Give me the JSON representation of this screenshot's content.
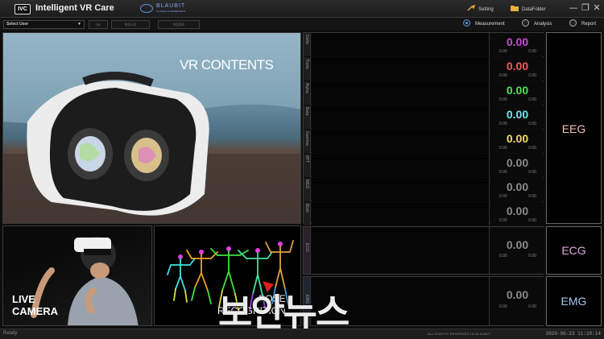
{
  "titlebar": {
    "logo": "IVC",
    "app_title": "Intelligent VR Care",
    "brand_name": "BLAUBIT",
    "brand_sub": "AI VISION & BIOMETRICS",
    "setting_label": "Setting",
    "datafolder_label": "DataFolder",
    "minimize_glyph": "—",
    "maximize_glyph": "❐",
    "close_glyph": "✕"
  },
  "toolbar": {
    "user_select_value": "Select User",
    "ok_label": "OK",
    "btn2_label": "측정시작",
    "btn3_label": "측정종료",
    "modes": [
      {
        "label": "Measurement",
        "selected": true
      },
      {
        "label": "Analysis",
        "selected": false
      },
      {
        "label": "Report",
        "selected": false
      }
    ]
  },
  "panels": {
    "vr_label": "VR CONTENTS",
    "camera_label_1": "LIVE",
    "camera_label_2": "CAMERA",
    "pose_label_1": "POSE",
    "pose_label_2": "RECOGNITION"
  },
  "eeg": {
    "section_label": "EEG",
    "section_color": "#f4c3b8",
    "channels": [
      {
        "name": "Delta",
        "value": "0.00",
        "min": "0.00",
        "max": "0.00",
        "color": "#c84bd6"
      },
      {
        "name": "Theta",
        "value": "0.00",
        "min": "0.00",
        "max": "0.00",
        "color": "#f05a5a"
      },
      {
        "name": "Alpha",
        "value": "0.00",
        "min": "0.00",
        "max": "0.00",
        "color": "#4fe05a"
      },
      {
        "name": "Beta",
        "value": "0.00",
        "min": "0.00",
        "max": "0.00",
        "color": "#6fe7f0"
      },
      {
        "name": "Gamma",
        "value": "0.00",
        "min": "0.00",
        "max": "0.00",
        "color": "#f5dc6a"
      },
      {
        "name": "ATT",
        "value": "0.00",
        "min": "0.00",
        "max": "0.00",
        "color": "#8a8a8a"
      },
      {
        "name": "MED",
        "value": "0.00",
        "min": "0.00",
        "max": "0.00",
        "color": "#8a8a8a"
      },
      {
        "name": "Blink",
        "value": "0.00",
        "min": "0.00",
        "max": "0.00",
        "color": "#8a8a8a"
      }
    ]
  },
  "ecg": {
    "section_label": "ECG",
    "channel": "ECG",
    "value": "0.00",
    "min": "0.00",
    "max": "0.00",
    "color": "#e8a8e8"
  },
  "emg": {
    "section_label": "EMG",
    "channel": "EMG",
    "value": "0.00",
    "min": "0.00",
    "max": "0.00",
    "color": "#a8c8f0"
  },
  "statusbar": {
    "status": "Ready",
    "rights": "ALL RIGHTS RESERVED IN BLAUBIT",
    "clock": "2020-06-23 11:10:14"
  },
  "watermark": "보안뉴스"
}
